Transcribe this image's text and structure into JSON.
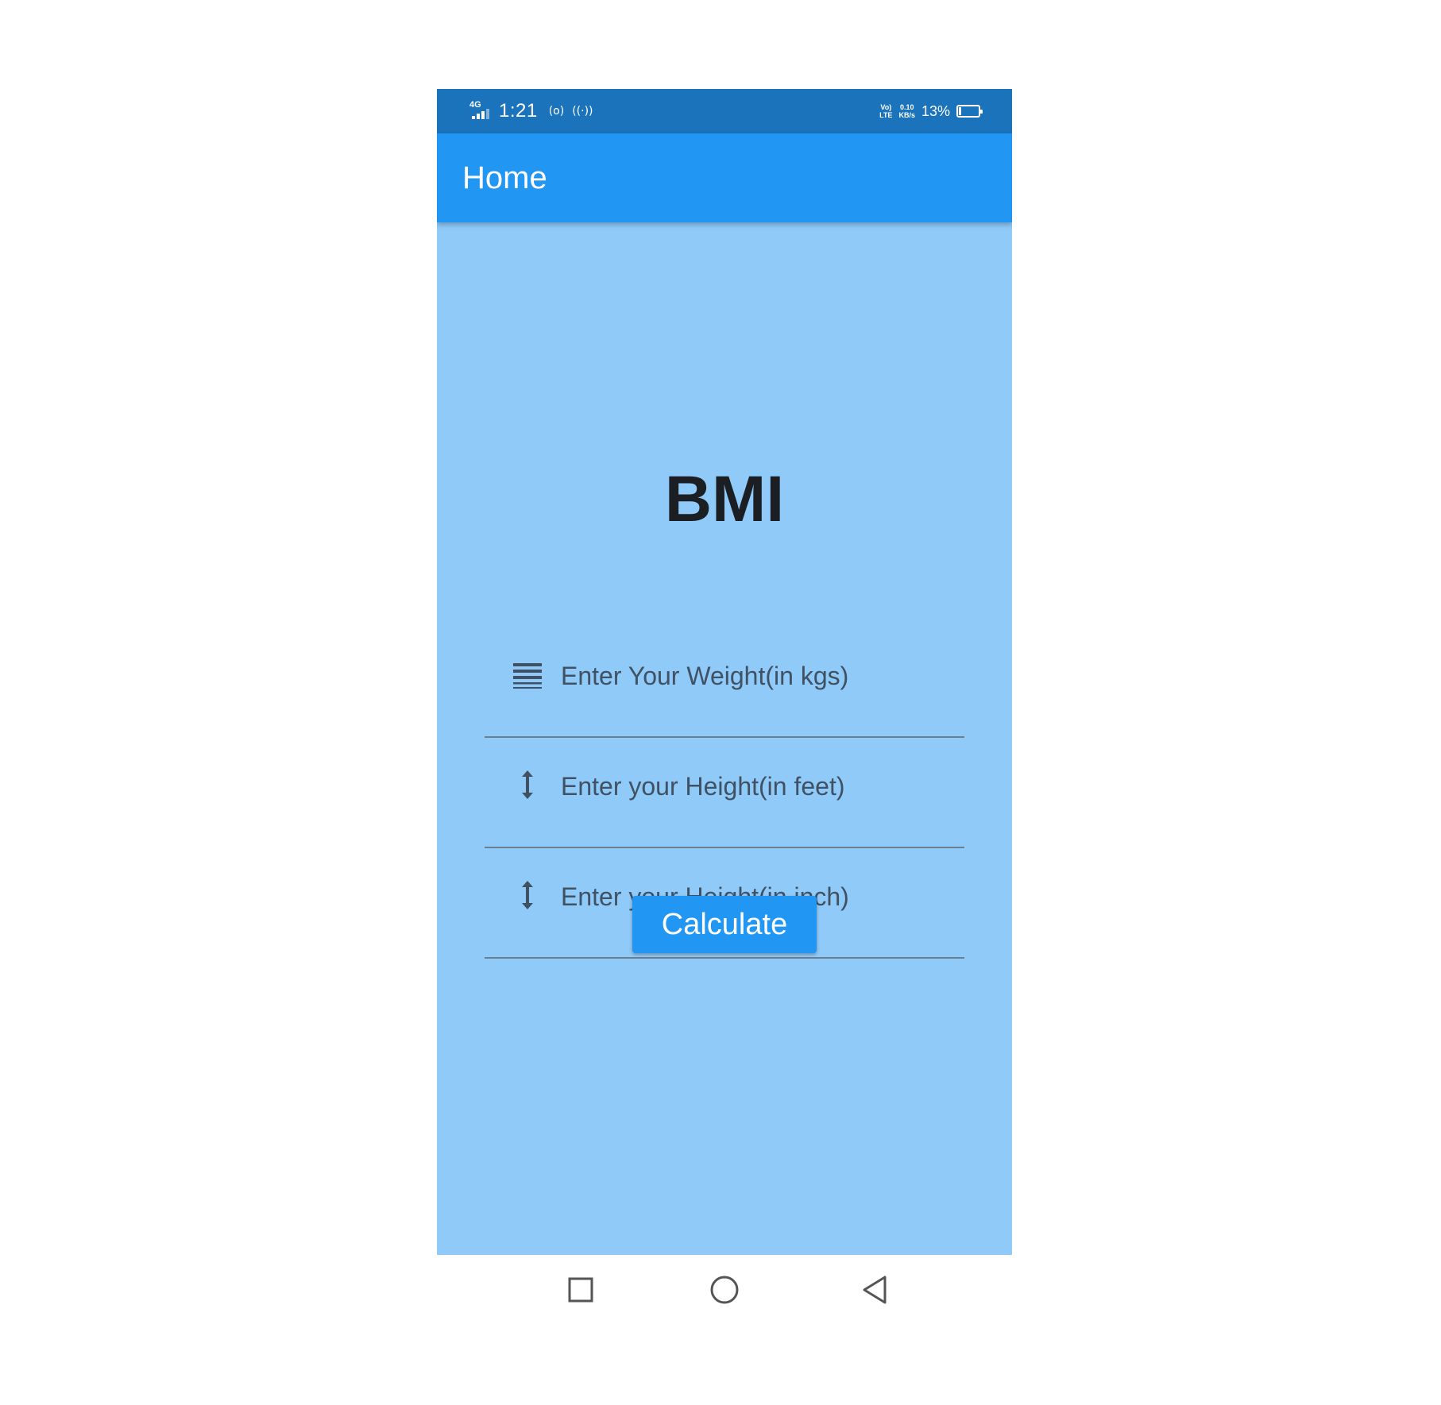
{
  "status_bar": {
    "network_type": "4G",
    "time": "1:21",
    "hotspot_glyph": "(o)",
    "data_glyph": "((·))",
    "volte_top": "Vo)",
    "volte_bottom": "LTE",
    "net_speed_value": "0.10",
    "net_speed_unit": "KB/s",
    "battery_percent": "13%",
    "battery_level": 0.13
  },
  "app_bar": {
    "title": "Home"
  },
  "main": {
    "heading": "BMI",
    "fields": [
      {
        "placeholder": "Enter Your Weight(in kgs)",
        "value": "",
        "icon": "weight-lines-icon"
      },
      {
        "placeholder": "Enter your Height(in feet)",
        "value": "",
        "icon": "height-arrow-icon"
      },
      {
        "placeholder": "Enter your Height(in inch)",
        "value": "",
        "icon": "height-arrow-icon"
      }
    ],
    "calculate_label": "Calculate"
  },
  "nav_bar": {
    "buttons": [
      "recents-square-icon",
      "home-circle-icon",
      "back-triangle-icon"
    ]
  },
  "colors": {
    "status_bar": "#1B73BB",
    "app_bar": "#2196F3",
    "background": "#90CAF9",
    "button": "#2196F3",
    "heading_text": "#1b1f24",
    "field_text": "#3f5163"
  }
}
